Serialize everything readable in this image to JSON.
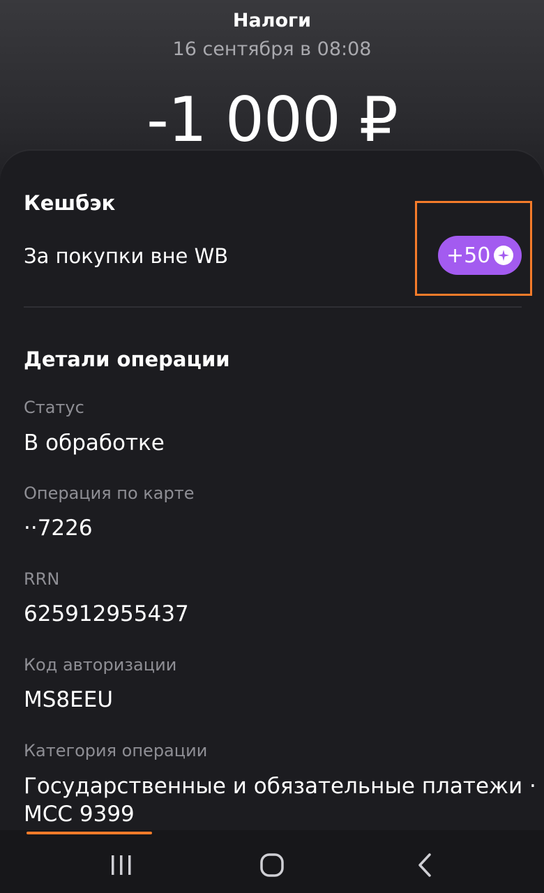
{
  "header": {
    "title": "Налоги",
    "datetime": "16 сентября в 08:08",
    "amount": "-1 000 ₽"
  },
  "cashback": {
    "section_title": "Кешбэк",
    "description": "За покупки вне WB",
    "badge": "+50",
    "badge_icon": "sparkle-coin-icon",
    "badge_color": "#a35bf0",
    "highlight_color": "#f47b2a"
  },
  "details": {
    "section_title": "Детали операции",
    "status_label": "Статус",
    "status_value": "В обработке",
    "card_label": "Операция по карте",
    "card_value": "··7226",
    "rrn_label": "RRN",
    "rrn_value": "625912955437",
    "auth_label": "Код авторизации",
    "auth_value": "MS8EEU",
    "category_label": "Категория операции",
    "category_value_line1": "Государственные и обязательные платежи ·",
    "category_value_line2": "MCC 9399"
  },
  "navbar": {
    "recent_icon": "recent-apps-icon",
    "home_icon": "home-icon",
    "back_icon": "back-icon"
  }
}
